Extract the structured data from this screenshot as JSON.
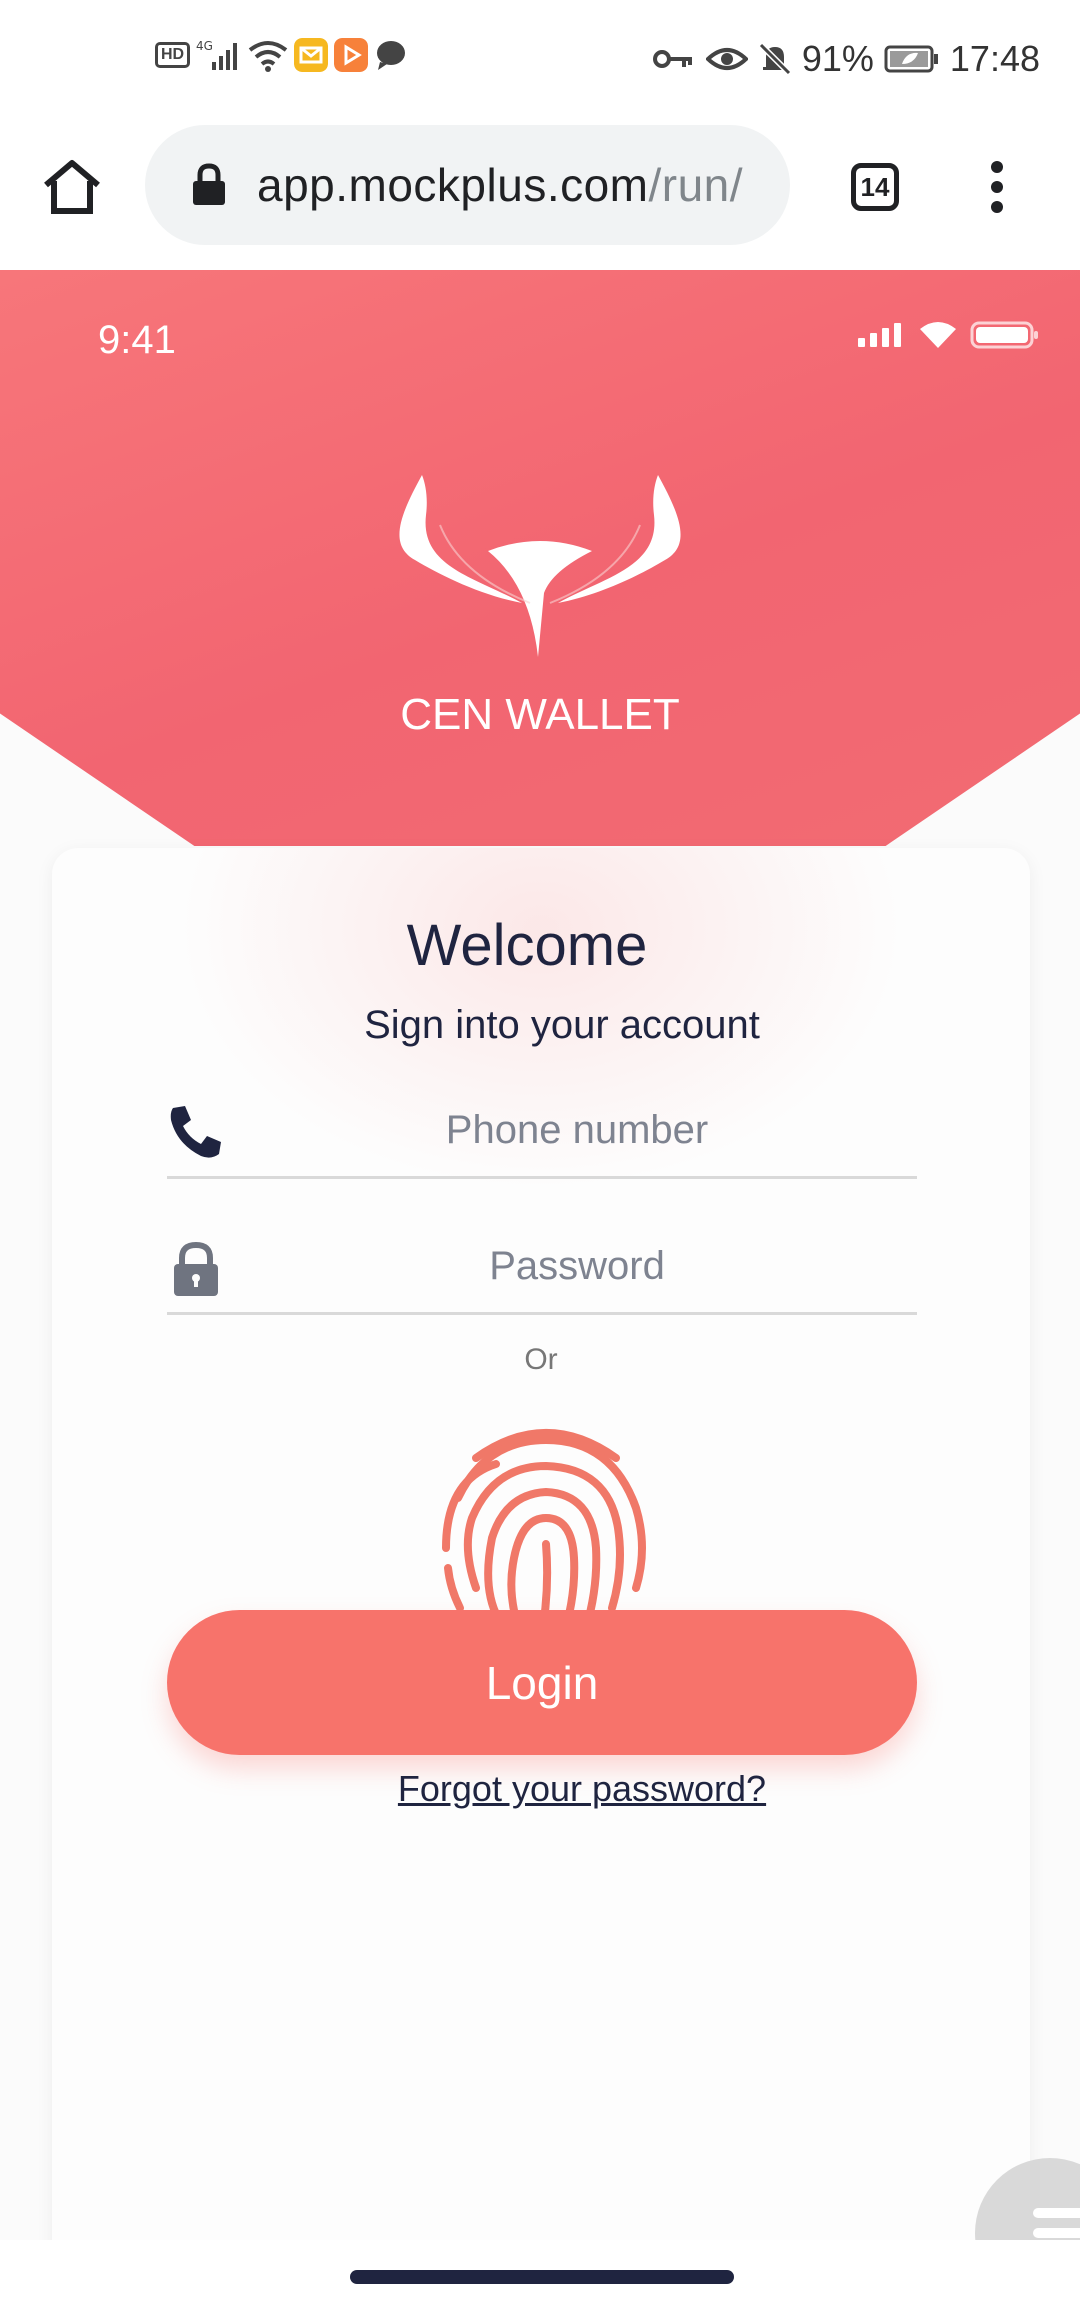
{
  "system_status": {
    "hd": "HD",
    "network": "4G",
    "battery": "91%",
    "clock": "17:48"
  },
  "browser": {
    "url_main": "app.mockplus.com",
    "url_dim": "/run/",
    "tab_count": "14"
  },
  "app": {
    "inner_time": "9:41",
    "brand": "CEN WALLET",
    "welcome": "Welcome",
    "subtitle": "Sign into your account",
    "phone_placeholder": "Phone number",
    "password_placeholder": "Password",
    "or_text": "Or",
    "login_label": "Login",
    "forgot_label": "Forgot your password?"
  },
  "colors": {
    "hero": "#f26b73",
    "login_button": "#f7736b",
    "fingerprint": "#f07868",
    "dark_text": "#1f2440"
  }
}
